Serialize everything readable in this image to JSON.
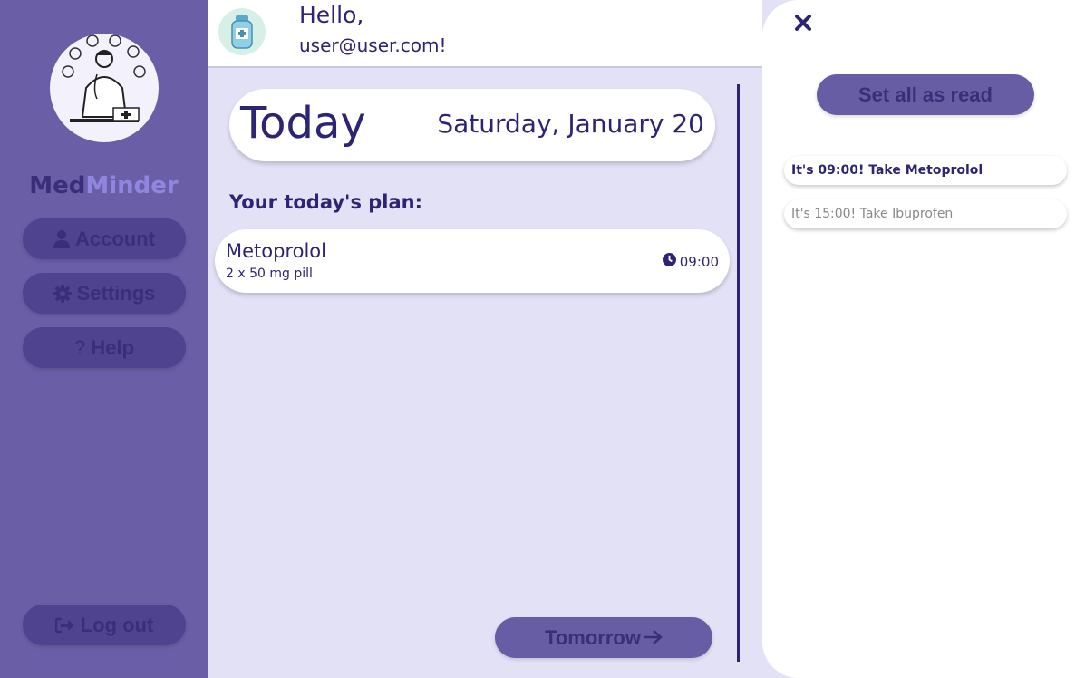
{
  "app": {
    "brand_part1": "Med",
    "brand_part2": "Minder"
  },
  "sidebar": {
    "items": [
      {
        "label": "Account",
        "icon": "user-icon"
      },
      {
        "label": "Settings",
        "icon": "gear-icon"
      },
      {
        "label": "Help",
        "icon": "question-icon"
      }
    ],
    "logout_label": "Log out"
  },
  "header": {
    "greeting": "Hello,",
    "user_email": "user@user.com!"
  },
  "today": {
    "title": "Today",
    "date": "Saturday, January 20"
  },
  "plan": {
    "heading": "Your today's plan:",
    "items": [
      {
        "name": "Metoprolol",
        "dose": "2 x 50 mg pill",
        "time": "09:00"
      }
    ]
  },
  "navigation": {
    "tomorrow_label": "Tomorrow"
  },
  "notifications": {
    "set_all_read_label": "Set all as read",
    "items": [
      {
        "text": "It's 09:00! Take Metoprolol",
        "read": false
      },
      {
        "text": "It's 15:00! Take Ibuprofen",
        "read": true
      }
    ]
  },
  "colors": {
    "sidebar_bg": "#6a5fa7",
    "accent_dark": "#2d2474",
    "button_bg": "#675da4",
    "content_bg": "#e3e1f6"
  }
}
